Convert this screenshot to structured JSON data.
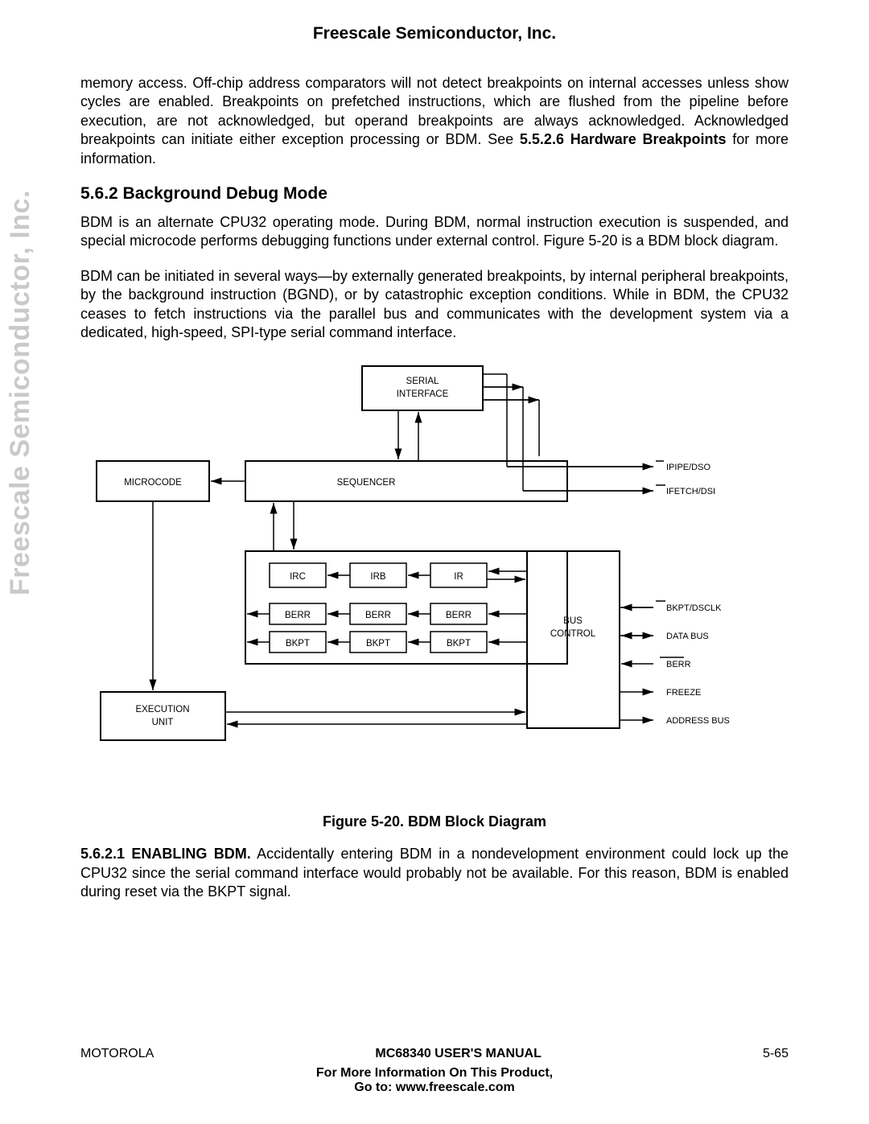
{
  "header": {
    "company": "Freescale Semiconductor, Inc."
  },
  "watermark": "Freescale Semiconductor, Inc.",
  "para1": {
    "text_a": "memory access. Off-chip address comparators will not detect breakpoints on internal accesses unless show cycles are enabled. Breakpoints on prefetched instructions, which are flushed from the pipeline before execution, are not acknowledged, but operand breakpoints are always acknowledged. Acknowledged breakpoints can initiate either exception processing or BDM. See ",
    "bold": "5.5.2.6 Hardware Breakpoints",
    "text_b": " for more information."
  },
  "section_heading": "5.6.2 Background Debug Mode",
  "para2": "BDM is an alternate CPU32 operating mode. During BDM, normal instruction execution is suspended, and special microcode performs debugging functions under external control. Figure 5-20 is a BDM block diagram.",
  "para3": "BDM can be initiated in several ways—by externally generated breakpoints, by internal peripheral breakpoints, by the background instruction (BGND), or by catastrophic exception conditions. While in BDM, the CPU32 ceases to fetch instructions via the parallel bus and communicates with the development system via a dedicated, high-speed, SPI-type serial command interface.",
  "figure_caption": "Figure 5-20. BDM Block Diagram",
  "para4": {
    "bold": "5.6.2.1 ENABLING BDM.",
    "text": " Accidentally entering BDM in a nondevelopment environment could lock up the CPU32 since the serial command interface would probably not be available. For this reason, BDM is enabled during reset via the BKPT signal."
  },
  "diagram": {
    "boxes": {
      "serial_interface_l1": "SERIAL",
      "serial_interface_l2": "INTERFACE",
      "microcode": "MICROCODE",
      "sequencer": "SEQUENCER",
      "irc": "IRC",
      "irb": "IRB",
      "ir": "IR",
      "berr": "BERR",
      "bkpt": "BKPT",
      "bus_control_l1": "BUS",
      "bus_control_l2": "CONTROL",
      "execution_unit_l1": "EXECUTION",
      "execution_unit_l2": "UNIT"
    },
    "signals": {
      "ipipe_dso": "IPIPE/DSO",
      "ifetch_dsi": "IFETCH/DSI",
      "bkpt_dsclk": "BKPT/DSCLK",
      "data_bus": "DATA BUS",
      "berr": "BERR",
      "freeze": "FREEZE",
      "address_bus": "ADDRESS BUS"
    }
  },
  "footer": {
    "left": "MOTOROLA",
    "center": "MC68340 USER'S MANUAL",
    "right": "5-65",
    "line1": "For More Information On This Product,",
    "line2": "Go to: www.freescale.com"
  }
}
